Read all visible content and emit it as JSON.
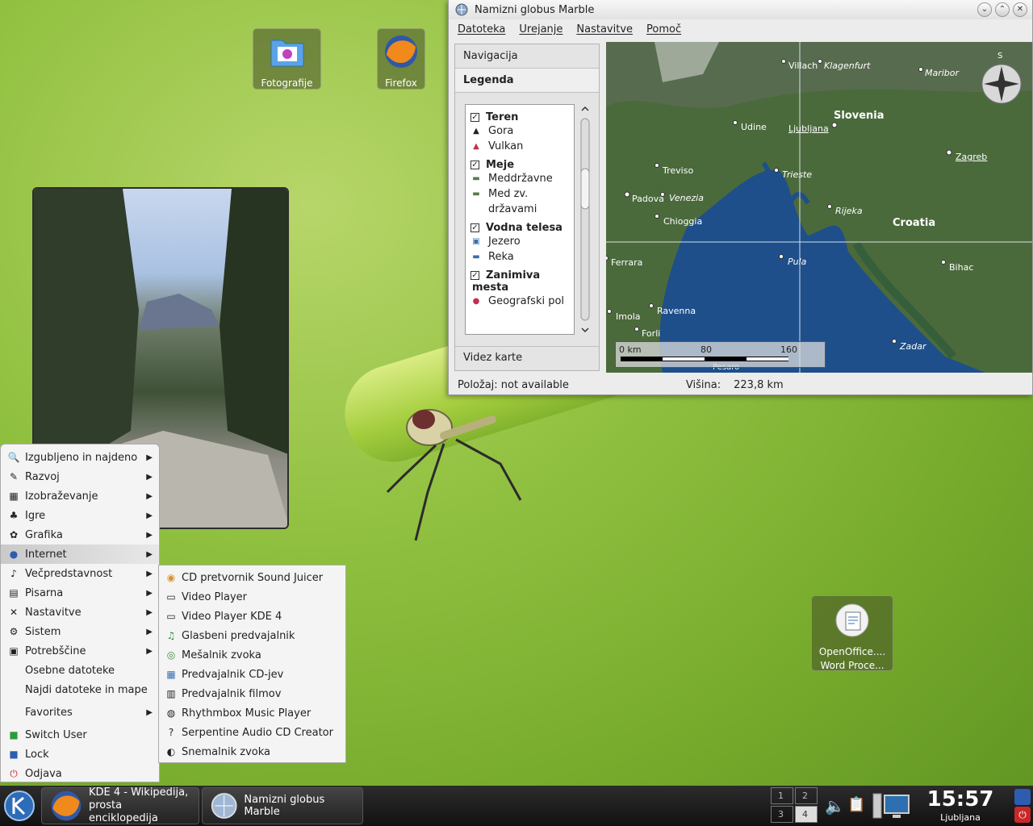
{
  "desktop": {
    "icons": [
      {
        "label": "Fotografije"
      },
      {
        "label": "Firefox"
      },
      {
        "label_line1": "OpenOffice....",
        "label_line2": "Word Proce..."
      }
    ]
  },
  "window": {
    "title": "Namizni globus Marble",
    "menu": [
      "Datoteka",
      "Urejanje",
      "Nastavitve",
      "Pomoč"
    ],
    "sidebar": {
      "tab_top": "Navigacija",
      "tab_active": "Legenda",
      "tab_bottom": "Videz karte",
      "groups": [
        {
          "title": "Teren",
          "items": [
            "Gora",
            "Vulkan"
          ]
        },
        {
          "title": "Meje",
          "items": [
            "Meddržavne",
            "Med zv.",
            "državami"
          ]
        },
        {
          "title": "Vodna telesa",
          "items": [
            "Jezero",
            "Reka"
          ]
        },
        {
          "title": "Zanimiva",
          "title2": "mesta",
          "items": [
            "Geografski pol"
          ]
        }
      ]
    },
    "map": {
      "countries": [
        "Slovenia",
        "Croatia"
      ],
      "cities": [
        "Villach",
        "Klagenfurt",
        "Maribor",
        "Udine",
        "Ljubljana",
        "Zagreb",
        "Treviso",
        "Trieste",
        "Padova",
        "Venezia",
        "Chioggia",
        "Rijeka",
        "Ferrara",
        "Pula",
        "Bihac",
        "Ravenna",
        "Imola",
        "Forli",
        "Zadar",
        "Pesaro"
      ],
      "scale": {
        "zero": "0 km",
        "mid": "80",
        "max": "160"
      },
      "compass_n": "S"
    },
    "status": {
      "position": "Položaj: not available",
      "altitude_label": "Višina:",
      "altitude_value": "223,8 km"
    }
  },
  "kmenu": {
    "items": [
      {
        "label": "Izgubljeno in najdeno",
        "icon": "lost-found-icon"
      },
      {
        "label": "Razvoj",
        "icon": "development-icon"
      },
      {
        "label": "Izobraževanje",
        "icon": "education-icon"
      },
      {
        "label": "Igre",
        "icon": "games-icon"
      },
      {
        "label": "Grafika",
        "icon": "graphics-icon"
      },
      {
        "label": "Internet",
        "icon": "internet-icon"
      },
      {
        "label": "Večpredstavnost",
        "icon": "multimedia-icon"
      },
      {
        "label": "Pisarna",
        "icon": "office-icon"
      },
      {
        "label": "Nastavitve",
        "icon": "settings-icon"
      },
      {
        "label": "Sistem",
        "icon": "system-icon"
      },
      {
        "label": "Potrebščine",
        "icon": "utilities-icon"
      }
    ],
    "personal": "Osebne datoteke",
    "find": "Najdi datoteke in mape",
    "favorites": "Favorites",
    "switch_user": "Switch User",
    "lock": "Lock",
    "logout": "Odjava"
  },
  "submenu": {
    "items": [
      "CD pretvornik Sound Juicer",
      "Video Player",
      "Video Player KDE 4",
      "Glasbeni predvajalnik",
      "Mešalnik zvoka",
      "Predvajalnik CD-jev",
      "Predvajalnik filmov",
      "Rhythmbox Music Player",
      "Serpentine Audio CD Creator",
      "Snemalnik zvoka"
    ]
  },
  "taskbar": {
    "task1_line1": "KDE 4 - Wikipedija,",
    "task1_line2": "prosta",
    "task1_line3": "enciklopedija",
    "task2": "Namizni globus Marble",
    "pager": [
      "1",
      "2",
      "3",
      "4"
    ],
    "time": "15:57",
    "city": "Ljubljana"
  }
}
